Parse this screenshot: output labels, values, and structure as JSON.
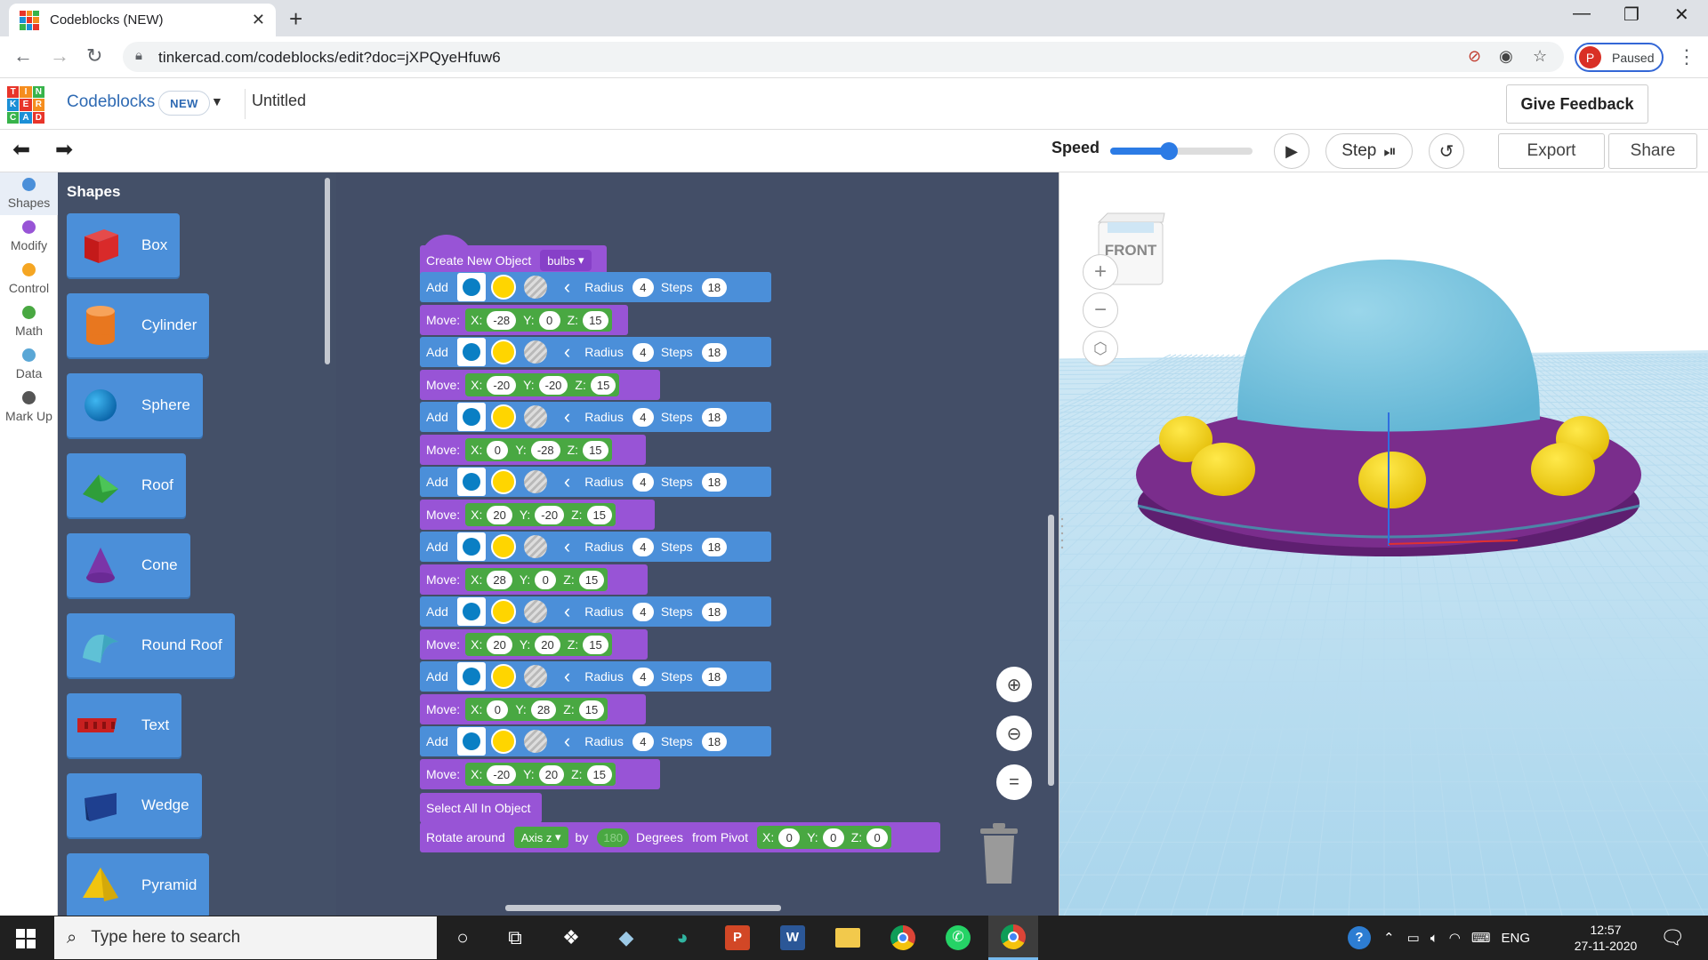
{
  "browser": {
    "tab_title": "Codeblocks (NEW)",
    "url": "tinkercad.com/codeblocks/edit?doc=jXPQyeHfuw6",
    "profile_initial": "P",
    "profile_status": "Paused"
  },
  "app": {
    "name": "Codeblocks",
    "badge": "NEW",
    "doc_title": "Untitled",
    "feedback": "Give Feedback",
    "logo_letters": [
      "T",
      "I",
      "N",
      "K",
      "E",
      "R",
      "C",
      "A",
      "D"
    ]
  },
  "toolbar": {
    "speed_label": "Speed",
    "speed_value": 0.41,
    "step": "Step",
    "export": "Export",
    "share": "Share"
  },
  "categories": [
    {
      "label": "Shapes",
      "color": "#4b8fd9",
      "active": true
    },
    {
      "label": "Modify",
      "color": "#9854d6"
    },
    {
      "label": "Control",
      "color": "#f5a623"
    },
    {
      "label": "Math",
      "color": "#49a842"
    },
    {
      "label": "Data",
      "color": "#5aa7d6"
    },
    {
      "label": "Mark Up",
      "color": "#555555"
    }
  ],
  "flyout": {
    "title": "Shapes",
    "shapes": [
      {
        "label": "Box",
        "icon": "box-icon"
      },
      {
        "label": "Cylinder",
        "icon": "cylinder-icon"
      },
      {
        "label": "Sphere",
        "icon": "sphere-icon"
      },
      {
        "label": "Roof",
        "icon": "roof-icon"
      },
      {
        "label": "Cone",
        "icon": "cone-icon"
      },
      {
        "label": "Round Roof",
        "icon": "round-roof-icon"
      },
      {
        "label": "Text",
        "icon": "text-shape-icon"
      },
      {
        "label": "Wedge",
        "icon": "wedge-icon"
      },
      {
        "label": "Pyramid",
        "icon": "pyramid-icon"
      }
    ]
  },
  "program": {
    "create_label": "Create New Object",
    "object_name": "bulbs",
    "add_label": "Add",
    "radius_label": "Radius",
    "steps_label": "Steps",
    "move_label": "Move:",
    "axis_x": "X:",
    "axis_y": "Y:",
    "axis_z": "Z:",
    "colors": {
      "shape": "#0a7fc4",
      "bulb": "#ffd500",
      "hole": "#b9b9b9"
    },
    "bulbs": [
      {
        "radius": "4",
        "steps": "18",
        "x": "-28",
        "y": "0",
        "z": "15"
      },
      {
        "radius": "4",
        "steps": "18",
        "x": "-20",
        "y": "-20",
        "z": "15"
      },
      {
        "radius": "4",
        "steps": "18",
        "x": "0",
        "y": "-28",
        "z": "15"
      },
      {
        "radius": "4",
        "steps": "18",
        "x": "20",
        "y": "-20",
        "z": "15"
      },
      {
        "radius": "4",
        "steps": "18",
        "x": "28",
        "y": "0",
        "z": "15"
      },
      {
        "radius": "4",
        "steps": "18",
        "x": "20",
        "y": "20",
        "z": "15"
      },
      {
        "radius": "4",
        "steps": "18",
        "x": "0",
        "y": "28",
        "z": "15"
      },
      {
        "radius": "4",
        "steps": "18",
        "x": "-20",
        "y": "20",
        "z": "15"
      }
    ],
    "select_all": "Select All In Object",
    "rotate": {
      "label": "Rotate around",
      "axis": "Axis z",
      "by": "by",
      "degrees_value": "180",
      "degrees_label": "Degrees",
      "pivot_label": "from Pivot",
      "x": "0",
      "y": "0",
      "z": "0"
    }
  },
  "viewport": {
    "view_cube_label": "FRONT",
    "colors": {
      "saucer": "#7a2d8c",
      "dome": "#7ec5de",
      "lights": "#f6d70e",
      "grid": "#b8dcef"
    }
  },
  "taskbar": {
    "search_placeholder": "Type here to search",
    "language": "ENG",
    "time": "12:57",
    "date": "27-11-2020"
  }
}
